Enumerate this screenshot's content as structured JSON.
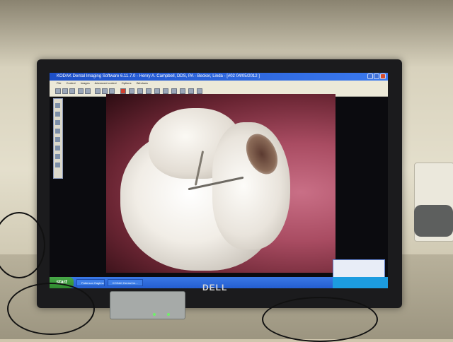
{
  "window": {
    "title": "KODAK Dental Imaging Software 6.11.7.0 - Henry A. Campbell, DDS, PA - Becker, Linda - [#02 04/05/2012 ]"
  },
  "menu": [
    "File",
    "Control",
    "Images",
    "Advanced control",
    "Options",
    "Windows"
  ],
  "taskbar": {
    "start_label": "start",
    "tasks": [
      "Patterson Eaglesoft",
      "KODAK Dental Im..."
    ]
  },
  "monitor": {
    "brand": "DELL"
  }
}
